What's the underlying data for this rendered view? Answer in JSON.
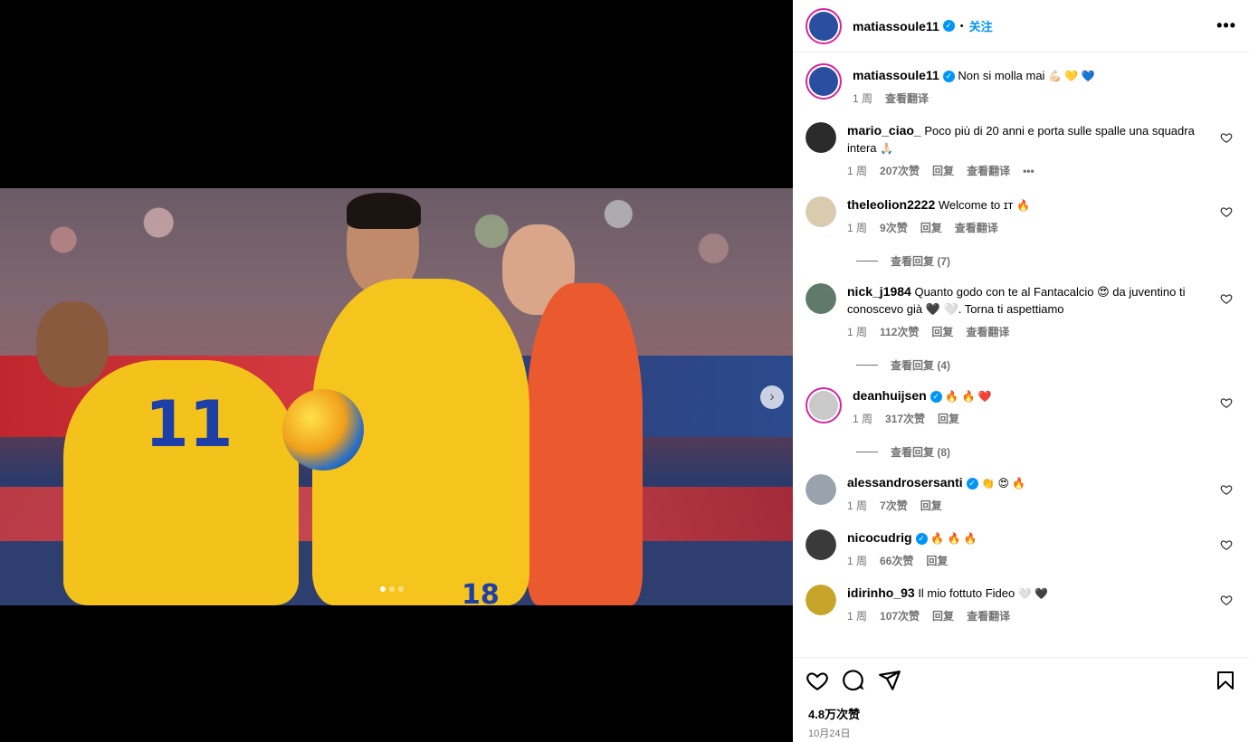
{
  "post": {
    "author": "matiassoule11",
    "follow_label": "关注",
    "dot": "•",
    "more": "•••",
    "caption_user": "matiassoule11",
    "caption_text": "Non si molla mai",
    "caption_emoji": "💪🏻 💛 💙",
    "caption_time": "1 周",
    "caption_translate": "查看翻译",
    "jersey_numbers": {
      "left": "11",
      "main": "18"
    },
    "carousel": {
      "total": 3,
      "active": 0
    }
  },
  "comments": [
    {
      "user": "mario_ciao_",
      "verified": false,
      "text": "Poco più di 20 anni e porta sulle spalle una squadra intera",
      "emoji": "🙏🏻",
      "time": "1 周",
      "likes": "207次赞",
      "reply": "回复",
      "translate": "查看翻译",
      "more": "•••",
      "replies": null,
      "avatar_color": "#2b2b2b"
    },
    {
      "user": "theleolion2222",
      "verified": false,
      "text": "Welcome to ɪᴛ",
      "emoji": "🔥",
      "time": "1 周",
      "likes": "9次赞",
      "reply": "回复",
      "translate": "查看翻译",
      "replies": "查看回复 (7)",
      "avatar_color": "#d9cbb0"
    },
    {
      "user": "nick_j1984",
      "verified": false,
      "text": "Quanto godo con te al Fantacalcio 😍 da juventino ti conoscevo già 🖤 🤍. Torna ti aspettiamo",
      "emoji": "",
      "time": "1 周",
      "likes": "112次赞",
      "reply": "回复",
      "translate": "查看翻译",
      "replies": "查看回复 (4)",
      "avatar_color": "#5f7a6a"
    },
    {
      "user": "deanhuijsen",
      "verified": true,
      "text": "",
      "emoji": "🔥 🔥 ❤️",
      "time": "1 周",
      "likes": "317次赞",
      "reply": "回复",
      "translate": "",
      "replies": "查看回复 (8)",
      "avatar_color": "#c9c9c9"
    },
    {
      "user": "alessandrosersanti",
      "verified": true,
      "text": "",
      "emoji": "👏 😍 🔥",
      "time": "1 周",
      "likes": "7次赞",
      "reply": "回复",
      "translate": "",
      "replies": null,
      "avatar_color": "#9aa3ad"
    },
    {
      "user": "nicocudrig",
      "verified": true,
      "text": "",
      "emoji": "🔥 🔥 🔥",
      "time": "1 周",
      "likes": "66次赞",
      "reply": "回复",
      "translate": "",
      "replies": null,
      "avatar_color": "#3a3a3a"
    },
    {
      "user": "idirinho_93",
      "verified": false,
      "text": "Il mio fottuto Fideo",
      "emoji": "🤍 🖤",
      "time": "1 周",
      "likes": "107次赞",
      "reply": "回复",
      "translate": "查看翻译",
      "replies": null,
      "avatar_color": "#c7a52a"
    }
  ],
  "footer": {
    "likes": "4.8万次赞",
    "date": "10月24日"
  },
  "icons": {
    "like": "heart-icon",
    "comment": "comment-icon",
    "share": "share-icon",
    "save": "bookmark-icon",
    "next": "chevron-right-icon",
    "more": "more-icon"
  },
  "colors": {
    "accent": "#0095f6",
    "muted": "#737373",
    "ring": "#d6249f"
  }
}
